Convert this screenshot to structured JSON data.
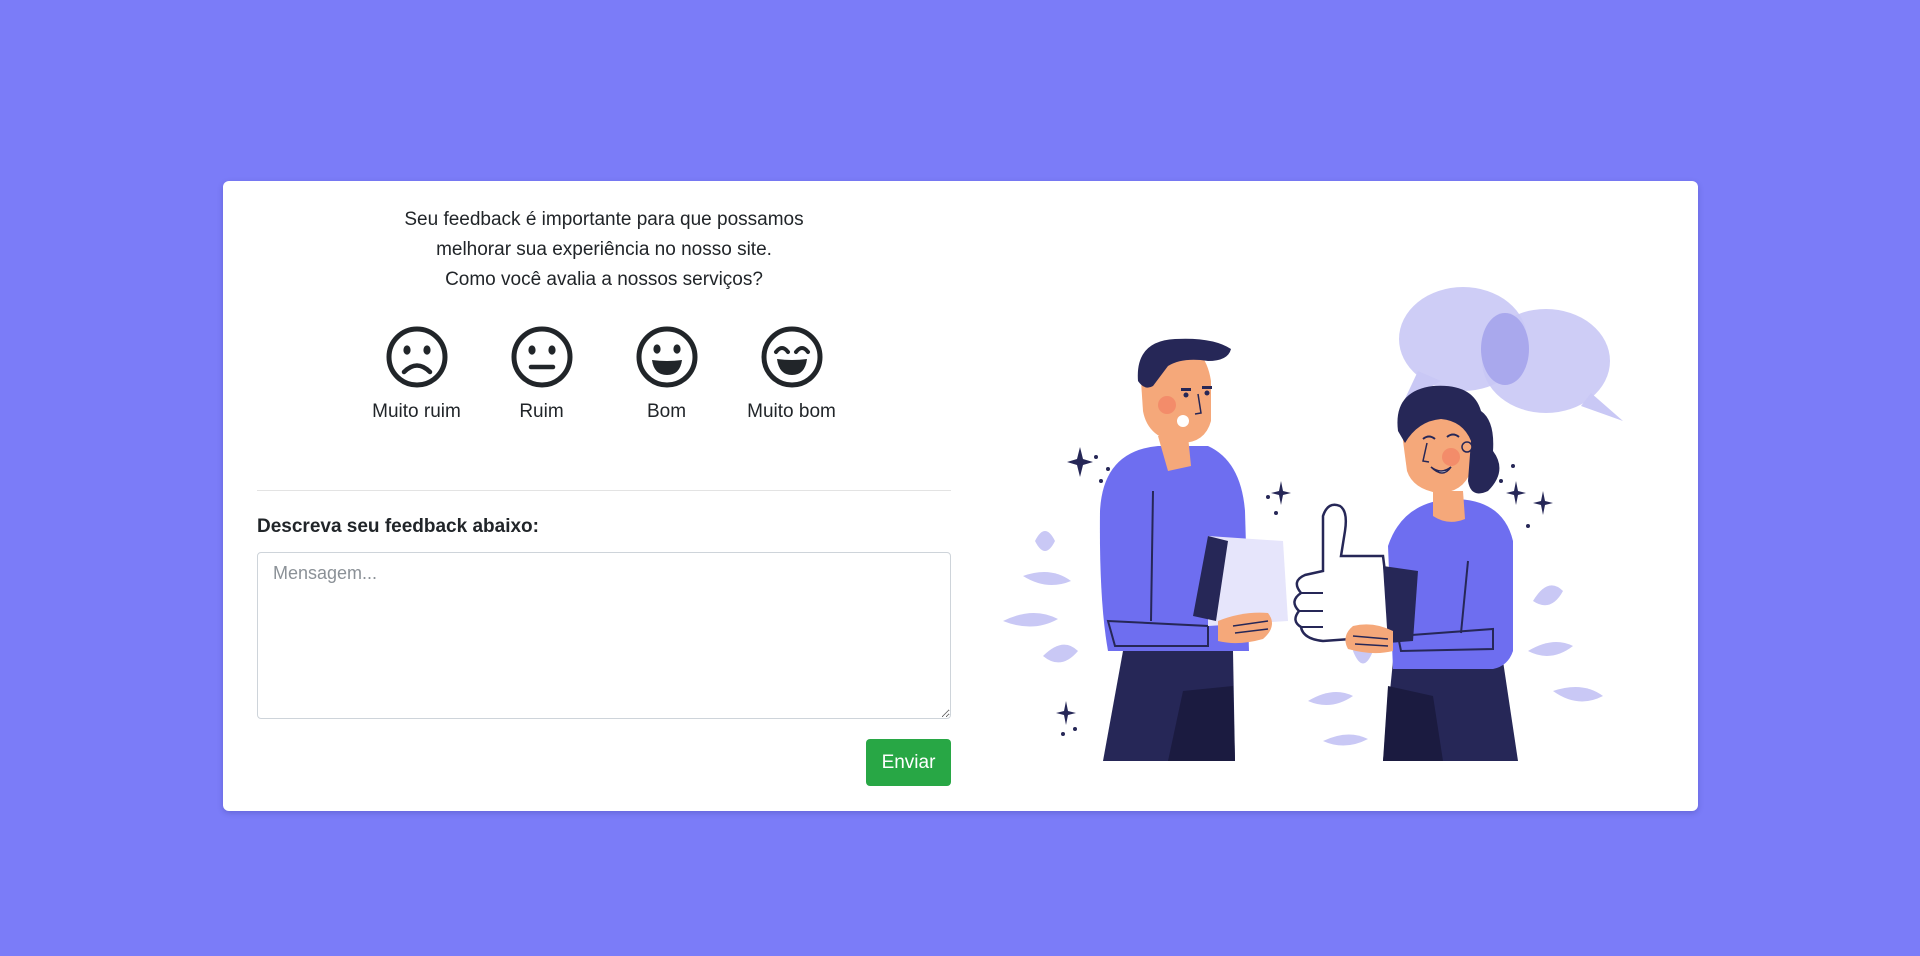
{
  "intro": {
    "line1": "Seu feedback é importante para que possamos",
    "line2": "melhorar sua experiência no nosso site.",
    "line3": "Como você avalia a nossos serviços?"
  },
  "ratings": [
    {
      "label": "Muito ruim",
      "icon": "very-sad-face-icon"
    },
    {
      "label": "Ruim",
      "icon": "neutral-face-icon"
    },
    {
      "label": "Bom",
      "icon": "happy-face-icon"
    },
    {
      "label": "Muito bom",
      "icon": "very-happy-face-icon"
    }
  ],
  "feedback": {
    "label": "Descreva seu feedback abaixo:",
    "placeholder": "Mensagem...",
    "value": ""
  },
  "submit": {
    "label": "Enviar"
  },
  "colors": {
    "background": "#7b7cf8",
    "card": "#ffffff",
    "accent_green": "#28a745",
    "illustration_purple": "#6e6ef0",
    "illustration_navy": "#262757"
  },
  "illustration": {
    "icon": "two-people-feedback-thumbs-up-illustration"
  }
}
